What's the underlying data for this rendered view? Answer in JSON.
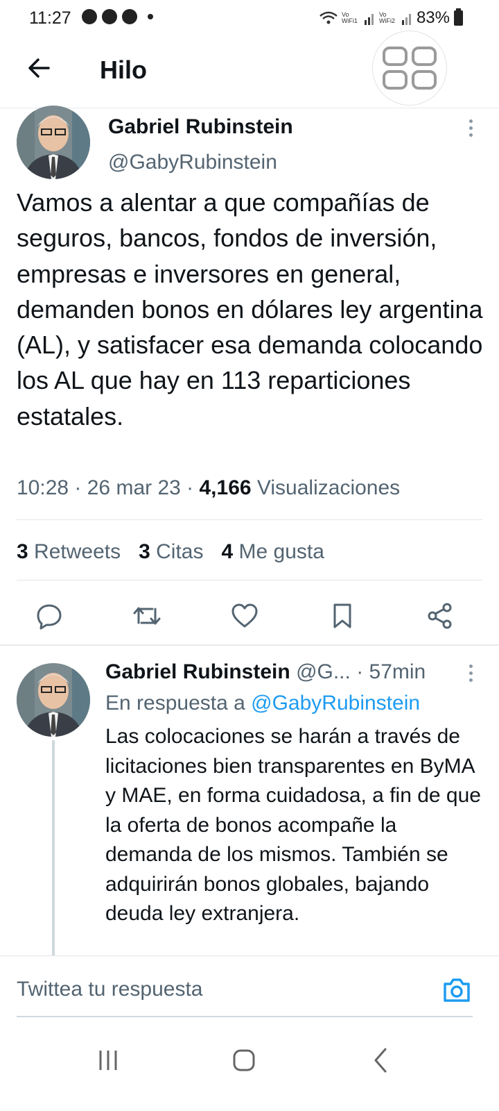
{
  "status_bar": {
    "time": "11:27",
    "battery": "83%",
    "wifi1_label": "Vo WiFi1",
    "wifi2_label": "Vo WiFi2"
  },
  "header": {
    "title": "Hilo"
  },
  "main_tweet": {
    "author_name": "Gabriel Rubinstein",
    "author_handle": "@GabyRubinstein",
    "text": "Vamos a alentar a que compañías de seguros, bancos, fondos de inversión, empresas e inversores en general, demanden bonos en dólares ley argentina (AL), y satisfacer esa demanda colocando los AL que hay en 113 reparticiones estatales.",
    "time": "10:28",
    "date": "26 mar 23",
    "views_count": "4,166",
    "views_label": "Visualizaciones",
    "retweets_count": "3",
    "retweets_label": "Retweets",
    "quotes_count": "3",
    "quotes_label": "Citas",
    "likes_count": "4",
    "likes_label": "Me gusta"
  },
  "reply_tweet": {
    "author_name": "Gabriel Rubinstein",
    "author_handle": "@G...",
    "time": "· 57min",
    "reply_prefix": "En respuesta a",
    "reply_to_handle": "@GabyRubinstein",
    "text": "Las colocaciones se harán a través de licitaciones bien transparentes en ByMA y MAE, en forma cuidadosa, a fin de que la oferta de bonos acompañe la demanda de los mismos. También se adquirirán bonos globales, bajando deuda ley extranjera."
  },
  "reply_bar": {
    "placeholder": "Twittea tu respuesta"
  },
  "colors": {
    "text_primary": "#0f1419",
    "text_secondary": "#536471",
    "accent": "#1d9bf0"
  },
  "icons": [
    "back-arrow-icon",
    "apps-grid-icon",
    "more-icon",
    "reply-icon",
    "retweet-icon",
    "like-icon",
    "bookmark-icon",
    "share-icon",
    "camera-icon",
    "recents-icon",
    "home-icon",
    "back-icon"
  ]
}
